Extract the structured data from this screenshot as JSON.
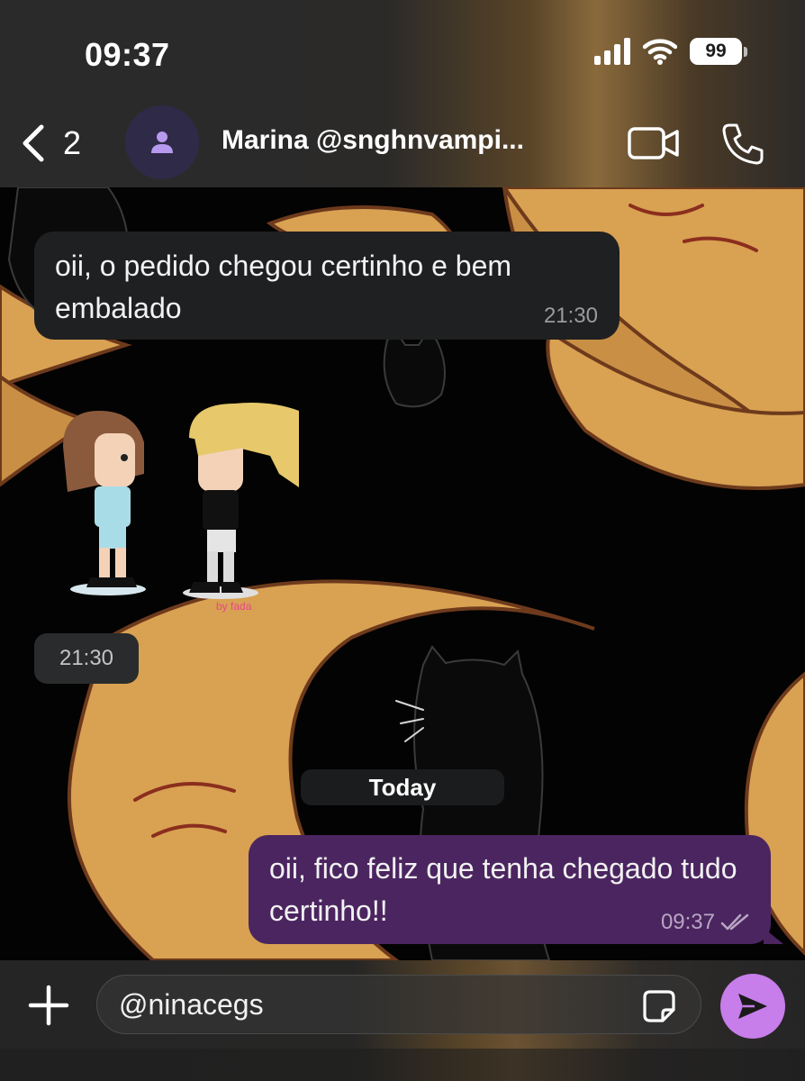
{
  "status_bar": {
    "time": "09:37",
    "battery": "99",
    "icons": [
      "cellular-signal-icon",
      "wifi-icon",
      "battery-icon"
    ]
  },
  "header": {
    "back_count": "2",
    "contact_name": "Marina @snghnvampi...",
    "icons": [
      "back-chevron-icon",
      "person-icon",
      "video-call-icon",
      "phone-icon"
    ]
  },
  "messages": [
    {
      "direction": "incoming",
      "text": "oii, o pedido chegou certinho e bem embalado",
      "time": "21:30"
    },
    {
      "direction": "incoming",
      "type": "sticker",
      "caption": "by fada",
      "time": "21:30"
    },
    {
      "direction": "outgoing",
      "text": "oii, fico feliz que tenha chegado tudo certinho!!",
      "time": "09:37",
      "status": "read"
    }
  ],
  "date_separator": "Today",
  "composer": {
    "value": "@ninacegs",
    "icons": [
      "plus-icon",
      "sticker-icon",
      "send-icon"
    ]
  },
  "colors": {
    "incoming_bubble": "#1f2021",
    "outgoing_bubble": "#4b2560",
    "send_button": "#c77dea",
    "avatar_bg": "#2e2a48",
    "avatar_icon": "#b79af0",
    "wallpaper_moon": "#d9a152"
  }
}
